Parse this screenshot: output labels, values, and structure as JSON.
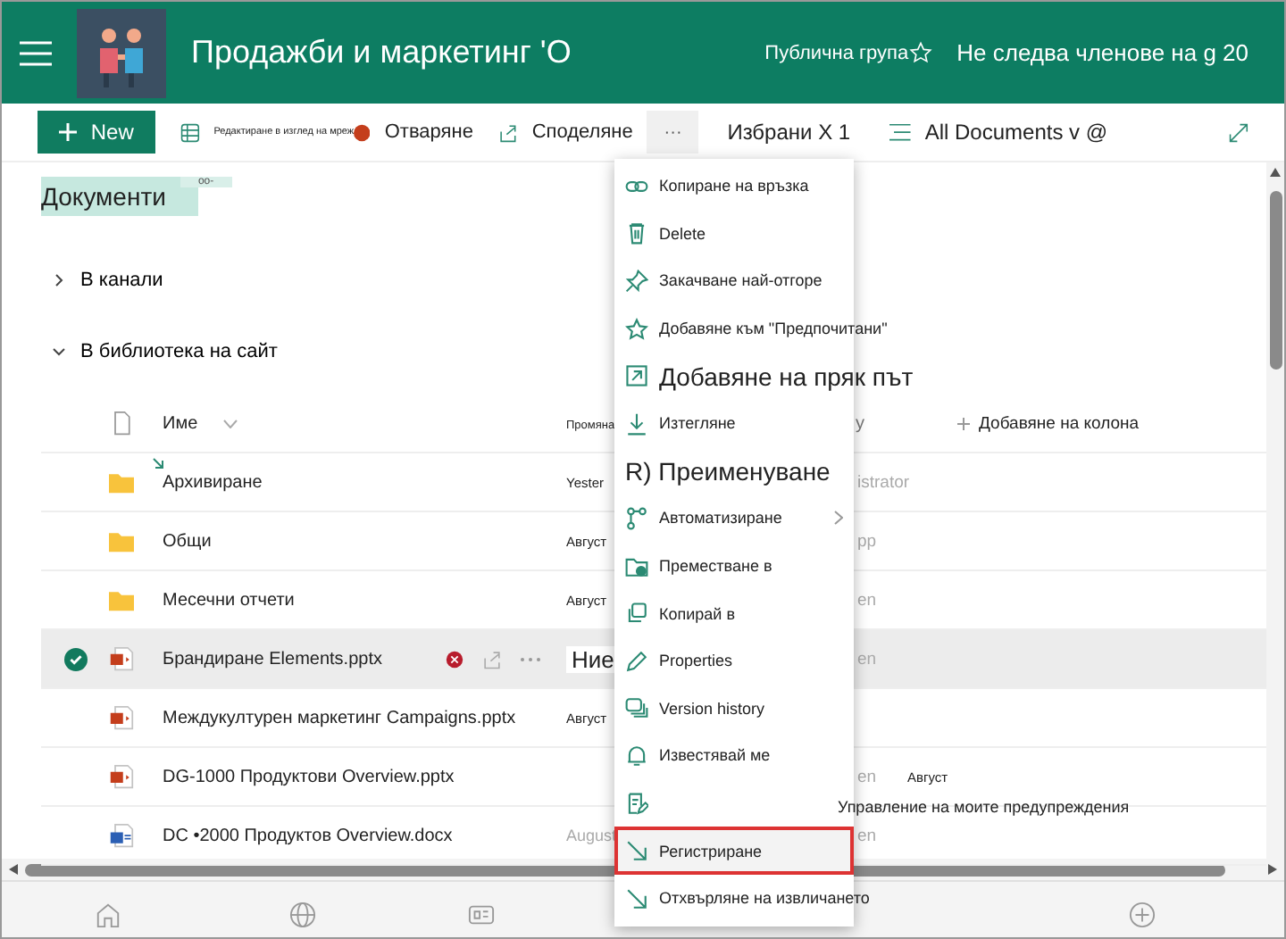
{
  "header": {
    "title": "Продажби и маркетинг 'O",
    "privacy": "Публична група",
    "follow": "Не следва членове на g 20"
  },
  "toolbar": {
    "new_button": "New",
    "grid_edit": "Редактиране в изглед на мреж",
    "open": "Отваряне",
    "share": "Споделяне",
    "more": "···",
    "selected_count": "Избрани X 1",
    "view": "All Documents v @"
  },
  "library": {
    "title": "Документи",
    "badge": "оо-"
  },
  "groups": [
    {
      "label": "В канали",
      "expanded": false
    },
    {
      "label": "В библиотека на сайт",
      "expanded": true
    }
  ],
  "table": {
    "columns": [
      "Име",
      "Промяна",
      "y",
      "Добавяне на колона"
    ],
    "rows": [
      {
        "kind": "folder",
        "name": "Архивиране",
        "is_new": true,
        "modified": "Yester",
        "modified_by": "istrator",
        "selected": false
      },
      {
        "kind": "folder",
        "name": "Общи",
        "is_new": false,
        "modified": "Август",
        "modified_by": "pp",
        "selected": false
      },
      {
        "kind": "folder",
        "name": "Месечни отчети",
        "is_new": false,
        "modified": "Август",
        "modified_by": "en",
        "selected": false
      },
      {
        "kind": "pptx",
        "name": "Брандиране Elements.pptx",
        "is_new": false,
        "modified": "Ние",
        "modified_by": "en",
        "selected": true
      },
      {
        "kind": "pptx",
        "name": "Междукултурен маркетинг Campaigns.pptx",
        "is_new": false,
        "modified": "Август",
        "selected": false
      },
      {
        "kind": "pptx",
        "name": "DG-1000 Продуктови Overview.pptx",
        "is_new": false,
        "modified_by": "en",
        "extra": "Август",
        "selected": false
      },
      {
        "kind": "docx",
        "name": "DC •2000 Продуктов Overview.docx",
        "is_new": false,
        "modified": "August",
        "modified_by": "en",
        "selected": false
      }
    ]
  },
  "context_menu": [
    {
      "kind": "link",
      "label": "Копиране на връзка",
      "large": false,
      "submenu": false,
      "selected": false
    },
    {
      "kind": "trash",
      "label": "Delete",
      "large": false,
      "submenu": false,
      "selected": false
    },
    {
      "kind": "pin",
      "label": "Закачване най-отгоре",
      "large": false,
      "submenu": false,
      "selected": false
    },
    {
      "kind": "star",
      "label": "Добавяне към \"Предпочитани\"",
      "large": false,
      "submenu": false,
      "selected": false
    },
    {
      "kind": "shortcut",
      "label": "Добавяне на пряк път",
      "large": true,
      "submenu": false,
      "selected": false
    },
    {
      "kind": "download",
      "label": "Изтегляне",
      "large": false,
      "submenu": false,
      "selected": false
    },
    {
      "kind": "none",
      "label": "R) Преименуване",
      "large": true,
      "submenu": false,
      "selected": false
    },
    {
      "kind": "flow",
      "label": "Автоматизиране",
      "large": false,
      "submenu": true,
      "selected": false
    },
    {
      "kind": "move",
      "label": "Преместване в",
      "large": false,
      "submenu": false,
      "selected": false
    },
    {
      "kind": "copy",
      "label": "Копирай в",
      "large": false,
      "submenu": false,
      "selected": false
    },
    {
      "kind": "pencil",
      "label": "Properties",
      "large": false,
      "submenu": false,
      "selected": false
    },
    {
      "kind": "versions",
      "label": "Version history",
      "large": false,
      "submenu": false,
      "selected": false
    },
    {
      "kind": "bell",
      "label": "Известявай ме",
      "large": false,
      "submenu": false,
      "selected": false
    },
    {
      "kind": "alerts",
      "label": "Управление на моите предупреждения",
      "large": false,
      "submenu": false,
      "selected": false
    },
    {
      "kind": "checkin",
      "label": "Регистриране",
      "large": false,
      "submenu": false,
      "selected": true
    },
    {
      "kind": "checkin",
      "label": "Отхвърляне на извличането",
      "large": false,
      "submenu": false,
      "selected": false
    }
  ]
}
